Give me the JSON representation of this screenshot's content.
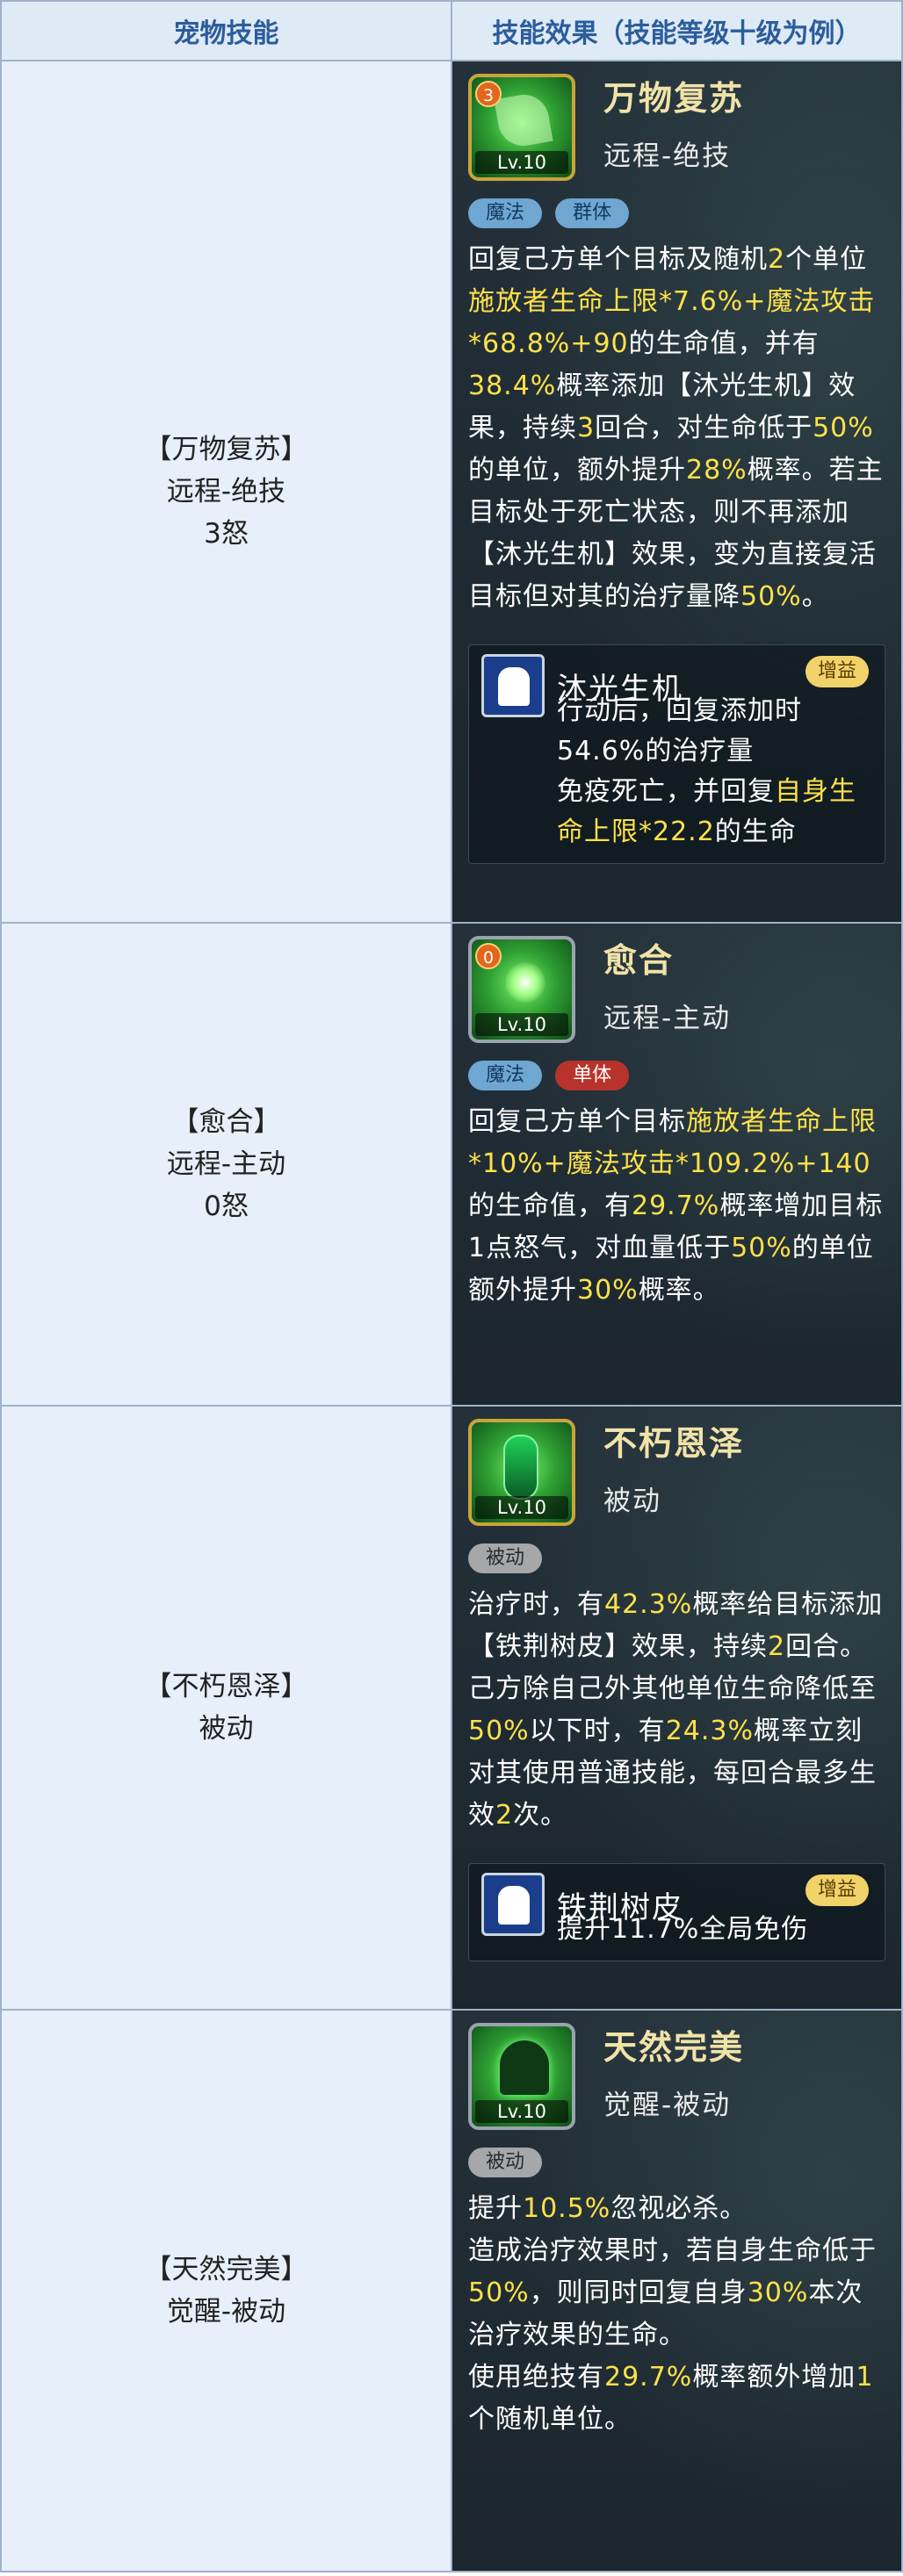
{
  "headers": {
    "col1": "宠物技能",
    "col2": "技能效果（技能等级十级为例）"
  },
  "skills": [
    {
      "cell_lines": [
        "【万物复苏】",
        "远程-绝技",
        "3怒"
      ],
      "icon": "leaf-skill-icon",
      "cost_badge": "3",
      "level": "Lv.10",
      "title": "万物复苏",
      "subtitle": "远程-绝技",
      "tags": [
        {
          "label": "魔法",
          "color": "blue"
        },
        {
          "label": "群体",
          "color": "blue"
        }
      ],
      "desc": [
        {
          "t": "回复己方单个目标及随机"
        },
        {
          "t": "2",
          "h": true
        },
        {
          "t": "个单位"
        },
        {
          "t": "施放者生命上限*7.6%+魔法攻击*68.8%+90",
          "h": true
        },
        {
          "t": "的生命值，并有"
        },
        {
          "t": "38.4%",
          "h": true
        },
        {
          "t": "概率添加【沐光生机】效果，持续"
        },
        {
          "t": "3",
          "h": true
        },
        {
          "t": "回合，对生命低于"
        },
        {
          "t": "50%",
          "h": true
        },
        {
          "t": "的单位，额外提升"
        },
        {
          "t": "28%",
          "h": true
        },
        {
          "t": "概率。若主目标处于死亡状态，则不再添加【沐光生机】效果，变为直接复活目标但对其的治疗量降"
        },
        {
          "t": "50%",
          "h": true
        },
        {
          "t": "。"
        }
      ],
      "buff": {
        "name": "沐光生机",
        "badge": "增益",
        "icon": "buff-person-icon",
        "lines": [
          [
            {
              "t": "行动后，回复添加时"
            },
            {
              "t": "54.6%",
              "h": false
            },
            {
              "t": "的治疗量"
            }
          ],
          [
            {
              "t": "免疫死亡，并回复"
            },
            {
              "t": "自身生命上限*22.2",
              "h": true
            },
            {
              "t": "的生命"
            }
          ]
        ]
      }
    },
    {
      "cell_lines": [
        "【愈合】",
        "远程-主动",
        "0怒"
      ],
      "icon": "heal-orb-icon",
      "cost_badge": "0",
      "level": "Lv.10",
      "title": "愈合",
      "subtitle": "远程-主动",
      "tags": [
        {
          "label": "魔法",
          "color": "blue"
        },
        {
          "label": "单体",
          "color": "red"
        }
      ],
      "desc": [
        {
          "t": "回复己方单个目标"
        },
        {
          "t": "施放者生命上限*10%+魔法攻击*109.2%+140",
          "h": true
        },
        {
          "t": "的生命值，有"
        },
        {
          "t": "29.7%",
          "h": true
        },
        {
          "t": "概率增加目标1点怒气，对血量低于"
        },
        {
          "t": "50%",
          "h": true
        },
        {
          "t": "的单位额外提升"
        },
        {
          "t": "30%",
          "h": true
        },
        {
          "t": "概率。"
        }
      ]
    },
    {
      "cell_lines": [
        "【不朽恩泽】",
        "被动"
      ],
      "icon": "pillar-icon",
      "level": "Lv.10",
      "title": "不朽恩泽",
      "subtitle": "被动",
      "tags": [
        {
          "label": "被动",
          "color": "gray"
        }
      ],
      "desc_paras": [
        [
          {
            "t": "治疗时，有"
          },
          {
            "t": "42.3%",
            "h": true
          },
          {
            "t": "概率给目标添加【铁荆树皮】效果，持续"
          },
          {
            "t": "2",
            "h": true
          },
          {
            "t": "回合。"
          }
        ],
        [
          {
            "t": "己方除自己外其他单位生命降低至"
          },
          {
            "t": "50%",
            "h": true
          },
          {
            "t": "以下时，有"
          },
          {
            "t": "24.3%",
            "h": true
          },
          {
            "t": "概率立刻对其使用普通技能，每回合最多生效"
          },
          {
            "t": "2",
            "h": true
          },
          {
            "t": "次。"
          }
        ]
      ],
      "buff": {
        "name": "铁荆树皮",
        "badge": "增益",
        "icon": "buff-person-icon",
        "lines": [
          [
            {
              "t": "提升"
            },
            {
              "t": "11.7%",
              "h": false
            },
            {
              "t": "全局免伤"
            }
          ]
        ]
      }
    },
    {
      "cell_lines": [
        "【天然完美】",
        "觉醒-被动"
      ],
      "icon": "nature-figure-icon",
      "level": "Lv.10",
      "title": "天然完美",
      "subtitle": "觉醒-被动",
      "tags": [
        {
          "label": "被动",
          "color": "gray"
        }
      ],
      "desc_paras": [
        [
          {
            "t": "提升"
          },
          {
            "t": "10.5%",
            "h": true
          },
          {
            "t": "忽视必杀。"
          }
        ],
        [
          {
            "t": "造成治疗效果时，若自身生命低于"
          },
          {
            "t": "50%",
            "h": true
          },
          {
            "t": "，则同时回复自身"
          },
          {
            "t": "30%",
            "h": true
          },
          {
            "t": "本次治疗效果的生命。"
          }
        ],
        [
          {
            "t": "使用绝技有"
          },
          {
            "t": "29.7%",
            "h": true
          },
          {
            "t": "概率额外增加"
          },
          {
            "t": "1",
            "h": true
          },
          {
            "t": "个随机单位。"
          }
        ]
      ]
    }
  ]
}
